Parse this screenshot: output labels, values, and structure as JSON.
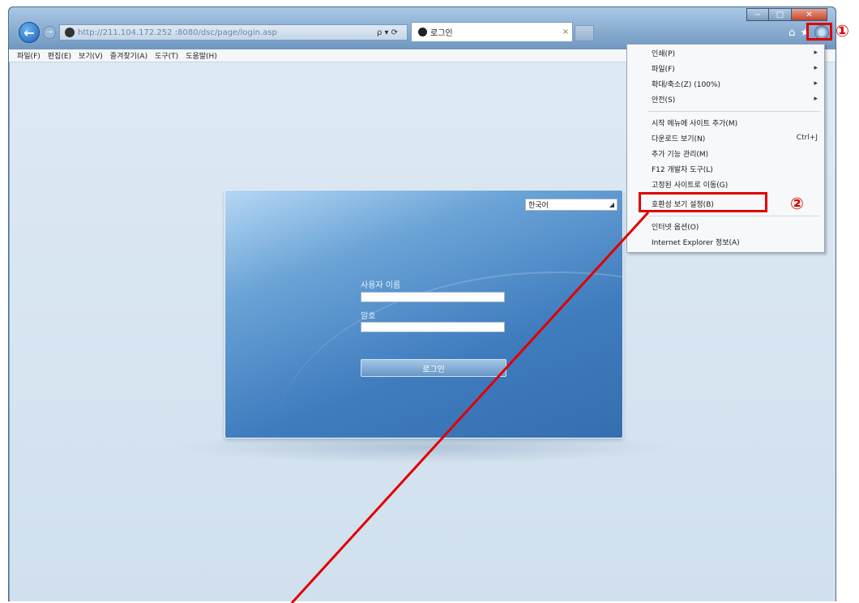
{
  "browser": {
    "address_url": "http://211.104.172.252 :8080/dsc/page/login.asp",
    "address_tools": "ρ ▾ ⟳",
    "tab_title": "로그인",
    "tab_close": "×"
  },
  "window_controls": {
    "minimize": "−",
    "maximize": "□",
    "close": "✕"
  },
  "menubar": [
    "파일(F)",
    "편집(E)",
    "보기(V)",
    "즐겨찾기(A)",
    "도구(T)",
    "도움말(H)"
  ],
  "gear_menu": {
    "items": [
      {
        "label": "인쇄(P)",
        "accessory": "▸"
      },
      {
        "label": "파일(F)",
        "accessory": "▸"
      },
      {
        "label": "확대/축소(Z) (100%)",
        "accessory": "▸"
      },
      {
        "label": "안전(S)",
        "accessory": "▸"
      },
      {
        "label": "시작 메뉴에 사이트 추가(M)",
        "accessory": ""
      },
      {
        "label": "다운로드 보기(N)",
        "accessory": "Ctrl+J"
      },
      {
        "label": "추가 기능 관리(M)",
        "accessory": ""
      },
      {
        "label": "F12 개발자 도구(L)",
        "accessory": ""
      },
      {
        "label": "고정된 사이트로 이동(G)",
        "accessory": ""
      },
      {
        "label": "호환성 보기 설정(B)",
        "accessory": ""
      },
      {
        "label": "인터넷 옵션(O)",
        "accessory": ""
      },
      {
        "label": "Internet Explorer 정보(A)",
        "accessory": ""
      }
    ]
  },
  "login": {
    "language": "한국어",
    "username_label": "사용자 이름",
    "password_label": "암호",
    "username_value": "",
    "password_value": "",
    "button_label": "로그인"
  },
  "annotations": {
    "step1": "①",
    "step2": "②",
    "color": "#e00000"
  },
  "icons": [
    "back-arrow-icon",
    "forward-arrow-icon",
    "globe-icon",
    "home-icon",
    "favorites-star-icon",
    "gear-icon",
    "dropdown-arrow-icon"
  ]
}
